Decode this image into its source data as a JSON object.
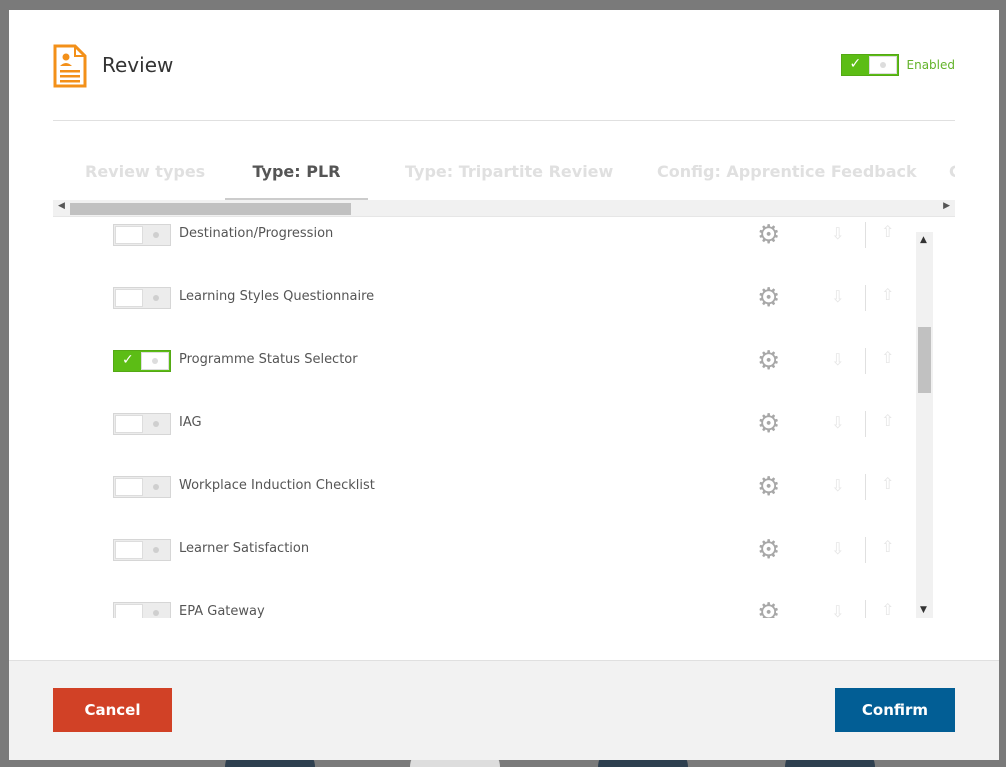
{
  "header": {
    "title": "Review",
    "icon": "review-document-icon",
    "enabled_label": "Enabled",
    "enabled": true
  },
  "colors": {
    "accent_orange": "#f39019",
    "toggle_on": "#5cbd15",
    "cancel": "#d14126",
    "confirm": "#025e95"
  },
  "tabs": [
    {
      "label": "Review types",
      "active": false
    },
    {
      "label": "Type: PLR",
      "active": true
    },
    {
      "label": "Type: Tripartite Review",
      "active": false
    },
    {
      "label": "Config: Apprentice Feedback",
      "active": false
    },
    {
      "label": "C",
      "active": false
    }
  ],
  "items": [
    {
      "label": "Destination/Progression",
      "enabled": false
    },
    {
      "label": "Learning Styles Questionnaire",
      "enabled": false
    },
    {
      "label": "Programme Status Selector",
      "enabled": true
    },
    {
      "label": "IAG",
      "enabled": false
    },
    {
      "label": "Workplace Induction Checklist",
      "enabled": false
    },
    {
      "label": "Learner Satisfaction",
      "enabled": false
    },
    {
      "label": "EPA Gateway",
      "enabled": false
    }
  ],
  "footer": {
    "cancel_label": "Cancel",
    "confirm_label": "Confirm"
  }
}
